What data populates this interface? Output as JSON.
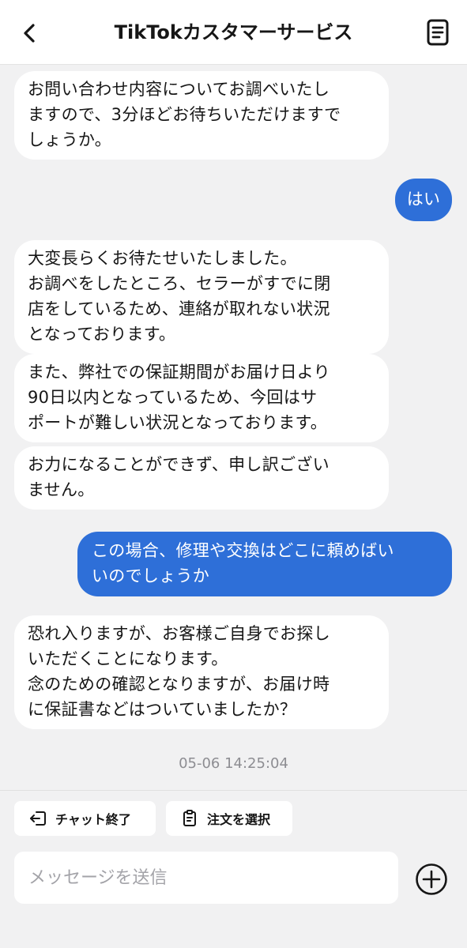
{
  "header": {
    "title": "TikTokカスタマーサービス",
    "back_icon": "chevron-left-icon",
    "doc_icon": "document-icon"
  },
  "messages": [
    {
      "from": "agent",
      "text": "お問い合わせ内容についてお調べいたし\nますので、3分ほどお待ちいただけますで\nしょうか。"
    },
    {
      "from": "user",
      "text": "はい"
    },
    {
      "from": "agent",
      "text": "大変長らくお待たせいたしました。\nお調べをしたところ、セラーがすでに閉\n店をしているため、連絡が取れない状況\nとなっております。"
    },
    {
      "from": "agent",
      "text": "また、弊社での保証期間がお届け日より\n90日以内となっているため、今回はサ\nポートが難しい状況となっております。"
    },
    {
      "from": "agent",
      "text": "お力になることができず、申し訳ござい\nません。"
    },
    {
      "from": "user",
      "text": "この場合、修理や交換はどこに頼めばい\nいのでしょうか"
    },
    {
      "from": "agent",
      "text": "恐れ入りますが、お客様ご自身でお探し\nいただくことになります。\n念のための確認となりますが、お届け時\nに保証書などはついていましたか？"
    }
  ],
  "timestamp": "05-06 14:25:04",
  "actions": {
    "end_chat_label": "チャット終了",
    "end_chat_icon": "exit-icon",
    "select_order_label": "注文を選択",
    "select_order_icon": "clipboard-icon"
  },
  "input": {
    "placeholder": "メッセージを送信",
    "value": ""
  },
  "plus_icon": "plus-circle-icon",
  "colors": {
    "user_bubble": "#2e6fd8",
    "agent_bubble": "#ffffff",
    "chat_background": "#f1f1f2",
    "timestamp_text": "#8d8d92"
  }
}
